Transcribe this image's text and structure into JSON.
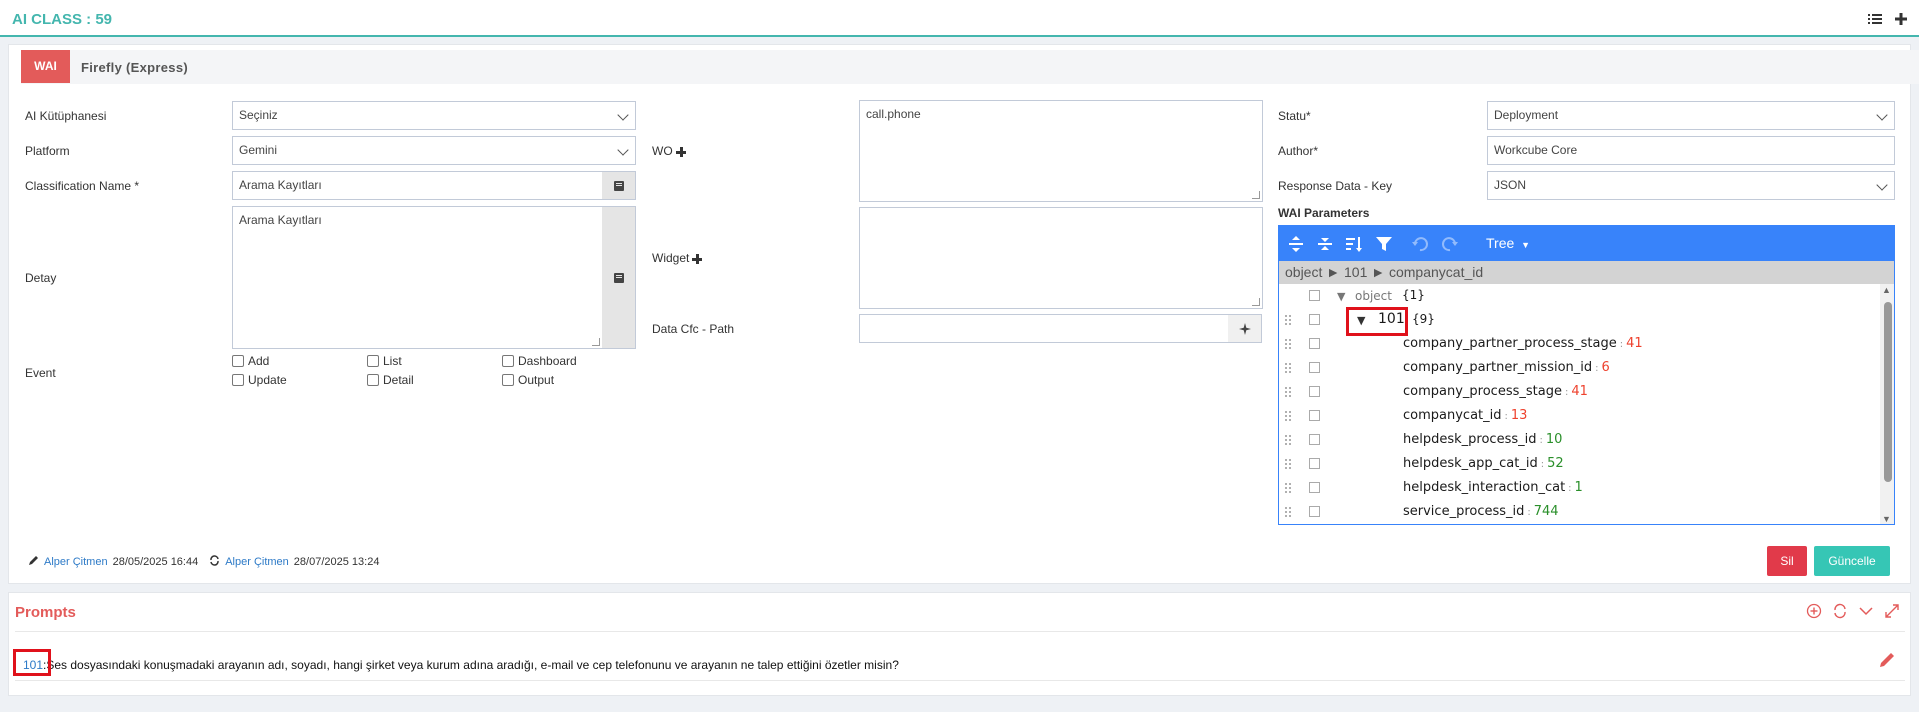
{
  "header": {
    "title": "AI CLASS : 59"
  },
  "wai": {
    "badge": "WAI",
    "name": "Firefly (Express)"
  },
  "form": {
    "ai_kutuphanesi": {
      "label": "AI Kütüphanesi",
      "value": "Seçiniz"
    },
    "platform": {
      "label": "Platform",
      "value": "Gemini"
    },
    "classification_name": {
      "label": "Classification Name *",
      "value": "Arama Kayıtları"
    },
    "detay": {
      "label": "Detay",
      "value": "Arama Kayıtları"
    },
    "event": {
      "label": "Event",
      "options": [
        "Add",
        "List",
        "Dashboard",
        "Update",
        "Detail",
        "Output"
      ]
    },
    "wo": {
      "label": "WO",
      "value": "call.phone"
    },
    "widget": {
      "label": "Widget",
      "value": ""
    },
    "data_cfc_path": {
      "label": "Data Cfc - Path",
      "value": ""
    },
    "statu": {
      "label": "Statu*",
      "value": "Deployment"
    },
    "author": {
      "label": "Author*",
      "value": "Workcube Core"
    },
    "response_data_key": {
      "label": "Response Data - Key",
      "value": "JSON"
    },
    "wai_parameters": {
      "label": "WAI Parameters"
    }
  },
  "json_editor": {
    "mode": "Tree",
    "breadcrumb": "object ► 101 ► companycat_id",
    "root": {
      "key": "object",
      "count": "{1}"
    },
    "node": {
      "key": "101",
      "count": "{9}"
    },
    "entries": [
      {
        "key": "company_partner_process_stage",
        "value": "41",
        "color": "#ee422e"
      },
      {
        "key": "company_partner_mission_id",
        "value": "6",
        "color": "#ee422e"
      },
      {
        "key": "company_process_stage",
        "value": "41",
        "color": "#ee422e"
      },
      {
        "key": "companycat_id",
        "value": "13",
        "color": "#ee422e"
      },
      {
        "key": "helpdesk_process_id",
        "value": "10",
        "color": "#2a8f2a"
      },
      {
        "key": "helpdesk_app_cat_id",
        "value": "52",
        "color": "#2a8f2a"
      },
      {
        "key": "helpdesk_interaction_cat",
        "value": "1",
        "color": "#2a8f2a"
      },
      {
        "key": "service_process_id",
        "value": "744",
        "color": "#2a8f2a"
      }
    ]
  },
  "record": {
    "created_by": "Alper Çitmen",
    "created_at": "28/05/2025 16:44",
    "updated_by": "Alper Çitmen",
    "updated_at": "28/07/2025 13:24"
  },
  "actions": {
    "delete": "Sil",
    "update": "Güncelle"
  },
  "prompts": {
    "title": "Prompts",
    "items": [
      {
        "id": "101",
        "text": "Ses dosyasındaki konuşmadaki arayanın adı, soyadı, hangi şirket veya kurum adına aradığı, e-mail ve cep telefonunu ve arayanın ne talep ettiğini özetler misin?"
      }
    ]
  },
  "colors": {
    "accent": "#44b6ae",
    "danger": "#e35b5a",
    "editor_blue": "#3883fa",
    "highlight": "#e0111b"
  }
}
